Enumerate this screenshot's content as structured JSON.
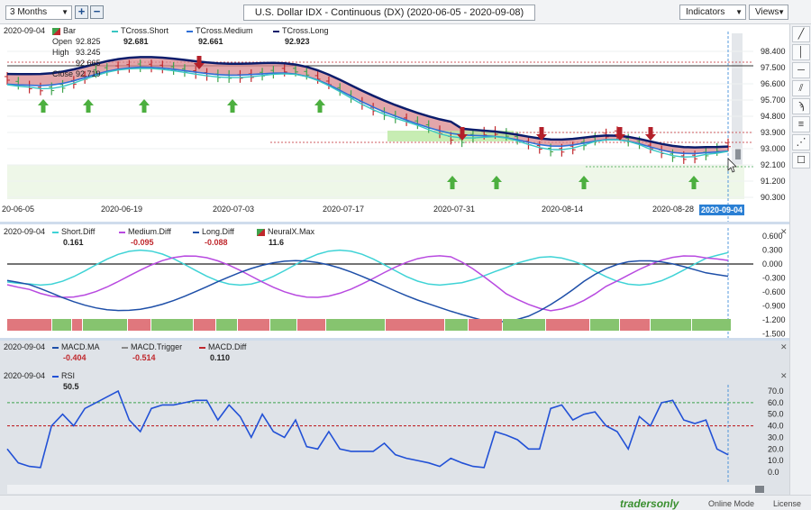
{
  "toolbar": {
    "period": "3 Months",
    "zoom_in": "+",
    "zoom_out": "−",
    "title": "U.S. Dollar IDX - Continuous (DX) (2020-06-05 - 2020-09-08)",
    "indicators": "Indicators",
    "views": "Views"
  },
  "price_panel": {
    "date": "2020-09-04",
    "bar_label": "Bar",
    "open_label": "Open",
    "open": "92.825",
    "high_label": "High",
    "high": "93.245",
    "low": "92.665",
    "close_label": "Close",
    "close": "92.719",
    "legend": [
      {
        "name": "TCross.Short",
        "value": "92.681",
        "color": "#39c6c2"
      },
      {
        "name": "TCross.Medium",
        "value": "92.661",
        "color": "#2f6fd6"
      },
      {
        "name": "TCross.Long",
        "value": "92.923",
        "color": "#0b1c6b"
      }
    ],
    "y_ticks": [
      "98.400",
      "97.500",
      "96.600",
      "95.700",
      "94.800",
      "93.900",
      "93.000",
      "92.100",
      "91.200",
      "90.300"
    ],
    "x_labels": [
      "20-06-05",
      "2020-06-19",
      "2020-07-03",
      "2020-07-17",
      "2020-07-31",
      "2020-08-14",
      "2020-08-28"
    ],
    "current_date": "2020-09-04"
  },
  "diff_panel": {
    "date": "2020-09-04",
    "legend": [
      {
        "name": "Short.Diff",
        "value": "0.161",
        "color": "#3fd3d6",
        "value_color": "#111111"
      },
      {
        "name": "Medium.Diff",
        "value": "-0.095",
        "color": "#b84ae0",
        "value_color": "#c0282d"
      },
      {
        "name": "Long.Diff",
        "value": "-0.088",
        "color": "#1e4fa8",
        "value_color": "#c0282d"
      },
      {
        "name": "NeuralX.Max",
        "value": "11.6",
        "color": "#3fa34d",
        "value_color": "#111111"
      }
    ],
    "y_ticks": [
      "0.600",
      "0.300",
      "0.000",
      "-0.300",
      "-0.600",
      "-0.900",
      "-1.200",
      "-1.500"
    ]
  },
  "macd_panel": {
    "date": "2020-09-04",
    "legend": [
      {
        "name": "MACD.MA",
        "value": "-0.404",
        "color": "#1e4fa8",
        "value_color": "#c0282d"
      },
      {
        "name": "MACD.Trigger",
        "value": "-0.514",
        "color": "#8a8a8a",
        "value_color": "#c0282d"
      },
      {
        "name": "MACD.Diff",
        "value": "0.110",
        "color": "#c0282d",
        "value_color": "#111111"
      }
    ]
  },
  "rsi_panel": {
    "date": "2020-09-04",
    "name": "RSI",
    "value": "50.5",
    "y_ticks": [
      "70.0",
      "60.0",
      "50.0",
      "40.0",
      "30.0",
      "20.0",
      "10.0",
      "0.0"
    ]
  },
  "footer": {
    "brand": "tradersonly",
    "online_mode": "Online Mode",
    "license": "License"
  },
  "colors": {
    "cloud_bear": "#d9888d",
    "cloud_bull": "#b9e9a0",
    "up_arrow": "#4caf3f",
    "down_arrow": "#b3202a",
    "rsi_line": "#2251d6"
  }
}
